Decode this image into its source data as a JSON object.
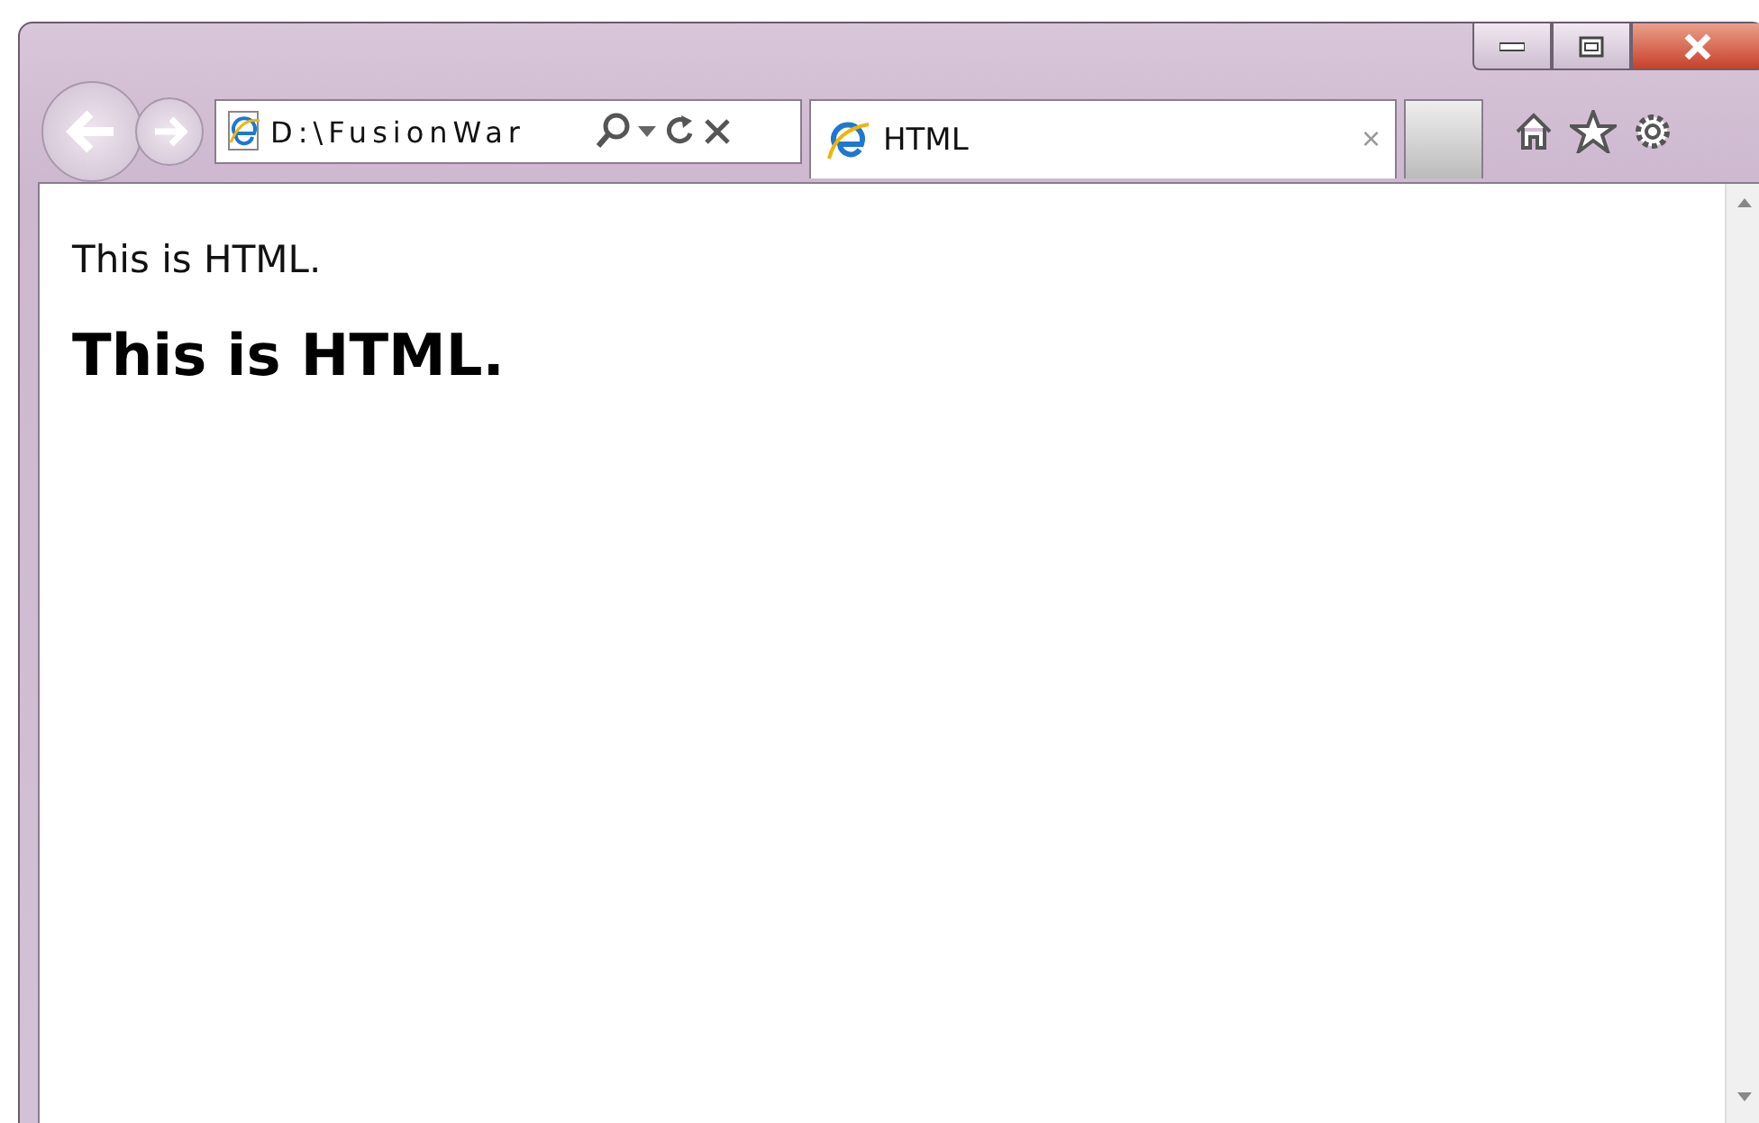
{
  "address_bar": {
    "value": "D:\\FusionWar"
  },
  "tabs": [
    {
      "label": "HTML",
      "selected": true,
      "close": "×"
    }
  ],
  "page": {
    "blocks": [
      {
        "kind": "paragraph",
        "text": "This is HTML."
      },
      {
        "kind": "heading",
        "text": "This is HTML."
      }
    ]
  }
}
